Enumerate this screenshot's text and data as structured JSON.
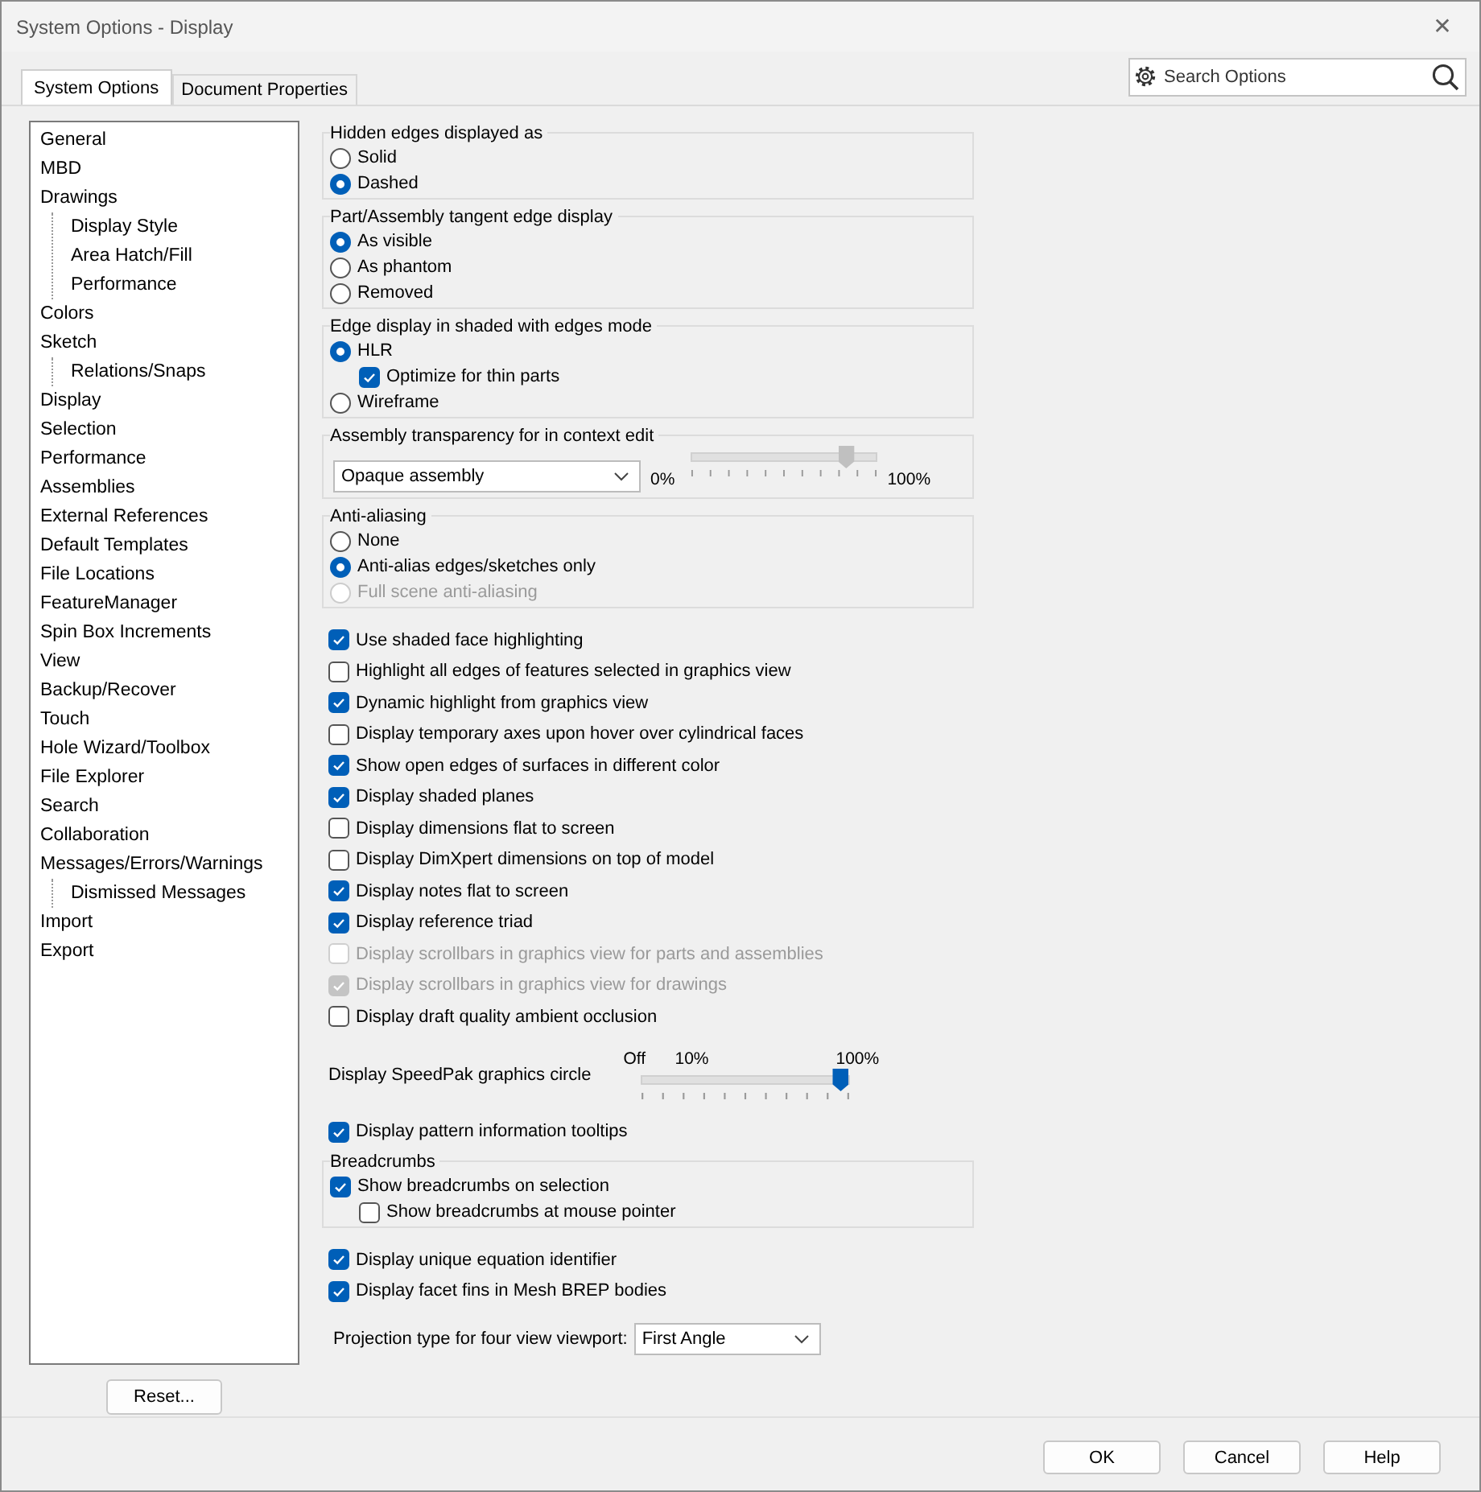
{
  "window": {
    "title": "System Options - Display",
    "close": "✕"
  },
  "tabs": [
    {
      "label": "System Options",
      "selected": true
    },
    {
      "label": "Document Properties",
      "selected": false
    }
  ],
  "search": {
    "placeholder": "Search Options"
  },
  "sidebar": {
    "items": [
      {
        "label": "General"
      },
      {
        "label": "MBD"
      },
      {
        "label": "Drawings",
        "children": [
          {
            "label": "Display Style"
          },
          {
            "label": "Area Hatch/Fill"
          },
          {
            "label": "Performance"
          }
        ]
      },
      {
        "label": "Colors"
      },
      {
        "label": "Sketch",
        "children": [
          {
            "label": "Relations/Snaps"
          }
        ]
      },
      {
        "label": "Display"
      },
      {
        "label": "Selection"
      },
      {
        "label": "Performance"
      },
      {
        "label": "Assemblies"
      },
      {
        "label": "External References"
      },
      {
        "label": "Default Templates"
      },
      {
        "label": "File Locations"
      },
      {
        "label": "FeatureManager"
      },
      {
        "label": "Spin Box Increments"
      },
      {
        "label": "View"
      },
      {
        "label": "Backup/Recover"
      },
      {
        "label": "Touch"
      },
      {
        "label": "Hole Wizard/Toolbox"
      },
      {
        "label": "File Explorer"
      },
      {
        "label": "Search"
      },
      {
        "label": "Collaboration"
      },
      {
        "label": "Messages/Errors/Warnings",
        "children": [
          {
            "label": "Dismissed Messages"
          }
        ]
      },
      {
        "label": "Import"
      },
      {
        "label": "Export"
      }
    ],
    "reset_button": "Reset..."
  },
  "content": [
    {
      "kind": "group",
      "title": "Hidden edges displayed as",
      "options": [
        {
          "kind": "radio",
          "label": "Solid",
          "selected": false,
          "disabled": false
        },
        {
          "kind": "radio",
          "label": "Dashed",
          "selected": true,
          "disabled": false
        }
      ]
    },
    {
      "kind": "group",
      "title": "Part/Assembly tangent edge display",
      "options": [
        {
          "kind": "radio",
          "label": "As visible",
          "selected": true,
          "disabled": false
        },
        {
          "kind": "radio",
          "label": "As phantom",
          "selected": false,
          "disabled": false
        },
        {
          "kind": "radio",
          "label": "Removed",
          "selected": false,
          "disabled": false
        }
      ]
    },
    {
      "kind": "group",
      "title": "Edge display in shaded with edges mode",
      "options": [
        {
          "kind": "radio",
          "label": "HLR",
          "selected": true,
          "disabled": false,
          "children": [
            {
              "kind": "check",
              "label": "Optimize for thin parts",
              "checked": true,
              "disabled": false
            }
          ]
        },
        {
          "kind": "radio",
          "label": "Wireframe",
          "selected": false,
          "disabled": false
        }
      ]
    },
    {
      "kind": "transparency",
      "title": "Assembly transparency for in context edit",
      "dropdown": "Opaque assembly",
      "min_label": "0%",
      "max_label": "100%",
      "level": 0.87,
      "disabled": true
    },
    {
      "kind": "group",
      "title": "Anti-aliasing",
      "options": [
        {
          "kind": "radio",
          "label": "None",
          "selected": false,
          "disabled": false
        },
        {
          "kind": "radio",
          "label": "Anti-alias edges/sketches only",
          "selected": true,
          "disabled": false
        },
        {
          "kind": "radio",
          "label": "Full scene anti-aliasing",
          "selected": false,
          "disabled": true
        }
      ]
    },
    {
      "kind": "check",
      "label": "Use shaded face highlighting",
      "checked": true,
      "disabled": false
    },
    {
      "kind": "check",
      "label": "Highlight all edges of features selected in graphics view",
      "checked": false,
      "disabled": false
    },
    {
      "kind": "check",
      "label": "Dynamic highlight from graphics view",
      "checked": true,
      "disabled": false
    },
    {
      "kind": "check",
      "label": "Display temporary axes upon hover over cylindrical faces",
      "checked": false,
      "disabled": false
    },
    {
      "kind": "check",
      "label": "Show open edges of surfaces in different color",
      "checked": true,
      "disabled": false
    },
    {
      "kind": "check",
      "label": "Display shaded planes",
      "checked": true,
      "disabled": false
    },
    {
      "kind": "check",
      "label": "Display dimensions flat to screen",
      "checked": false,
      "disabled": false
    },
    {
      "kind": "check",
      "label": "Display DimXpert dimensions on top of model",
      "checked": false,
      "disabled": false
    },
    {
      "kind": "check",
      "label": "Display notes flat to screen",
      "checked": true,
      "disabled": false
    },
    {
      "kind": "check",
      "label": "Display reference triad",
      "checked": true,
      "disabled": false
    },
    {
      "kind": "check",
      "label": "Display scrollbars in graphics view for parts and assemblies",
      "checked": false,
      "disabled": true
    },
    {
      "kind": "check",
      "label": "Display scrollbars in graphics view for drawings",
      "checked": true,
      "disabled": true
    },
    {
      "kind": "check",
      "label": "Display draft quality ambient occlusion",
      "checked": false,
      "disabled": false
    },
    {
      "kind": "speedpak",
      "label": "Display SpeedPak graphics circle",
      "tick_labels": [
        "Off",
        "10%",
        "100%"
      ],
      "level": 1.0
    },
    {
      "kind": "check",
      "label": "Display pattern information tooltips",
      "checked": true,
      "disabled": false
    },
    {
      "kind": "group",
      "title": "Breadcrumbs",
      "options": [
        {
          "kind": "check",
          "label": "Show breadcrumbs on selection",
          "checked": true,
          "disabled": false,
          "children": [
            {
              "kind": "check",
              "label": "Show breadcrumbs at mouse pointer",
              "checked": false,
              "disabled": false
            }
          ]
        }
      ]
    },
    {
      "kind": "check",
      "label": "Display unique equation identifier",
      "checked": true,
      "disabled": false
    },
    {
      "kind": "check",
      "label": "Display facet fins in Mesh BREP bodies",
      "checked": true,
      "disabled": false
    },
    {
      "kind": "select",
      "label": "Projection type for four view viewport:",
      "value": "First Angle"
    }
  ],
  "buttons": [
    "OK",
    "Cancel",
    "Help"
  ]
}
